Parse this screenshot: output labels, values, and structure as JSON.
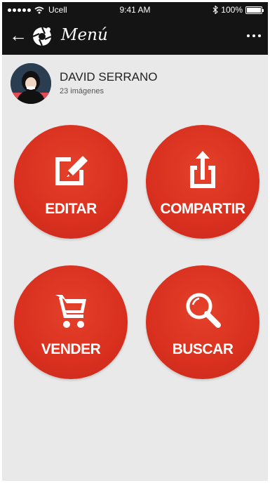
{
  "status_bar": {
    "carrier": "Ucell",
    "time": "9:41 AM",
    "battery": "100%",
    "battery_level": 1.0
  },
  "nav": {
    "title": "Menú",
    "back_icon": "back-arrow-icon",
    "logo_icon": "camera-aperture-logo",
    "more_icon": "more-dots-icon"
  },
  "profile": {
    "name": "DAVID SERRANO",
    "subtitle": "23 imágenes"
  },
  "actions": [
    {
      "label": "EDITAR",
      "icon": "edit-icon"
    },
    {
      "label": "COMPARTIR",
      "icon": "share-icon"
    },
    {
      "label": "VENDER",
      "icon": "cart-icon"
    },
    {
      "label": "BUSCAR",
      "icon": "search-icon"
    }
  ],
  "colors": {
    "accent": "#d9301f",
    "bar": "#141414",
    "background": "#e9e9e9"
  }
}
